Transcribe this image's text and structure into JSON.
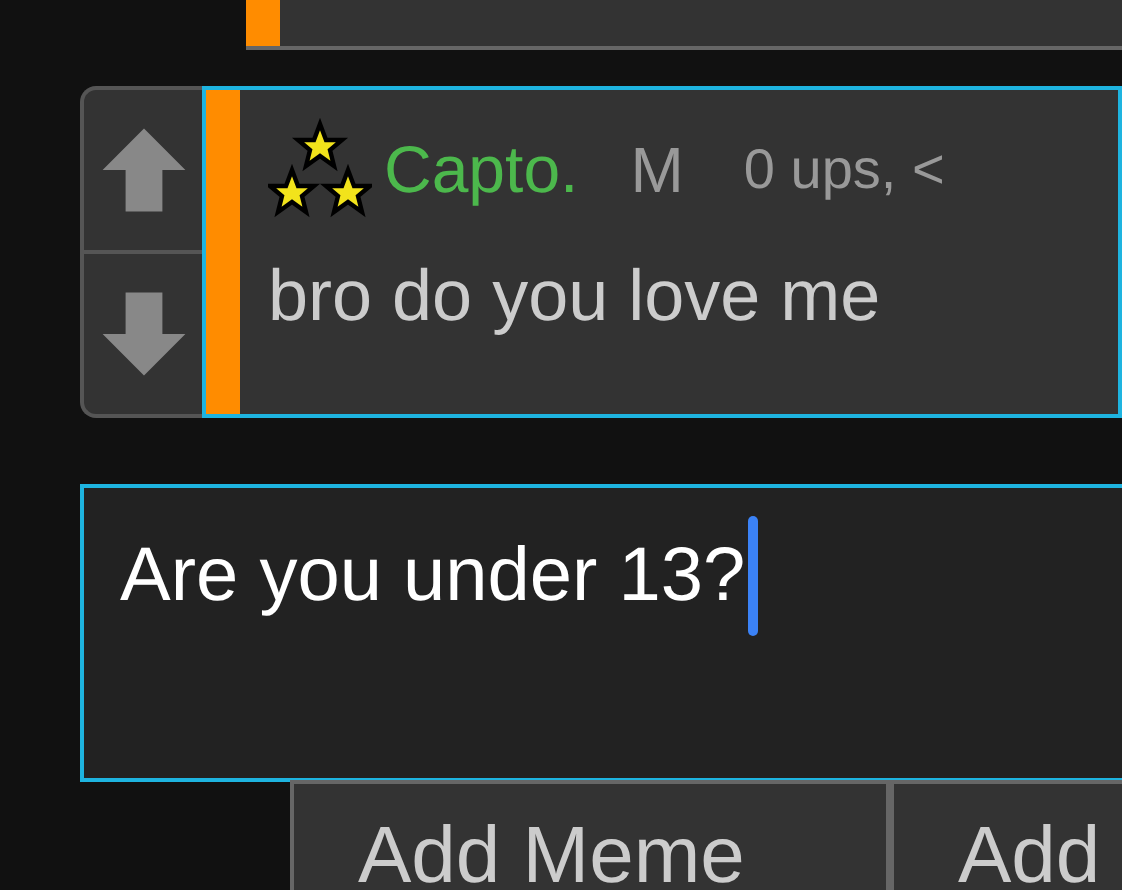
{
  "comment": {
    "vote_up": {
      "kind": "up"
    },
    "vote_down": {
      "kind": "down"
    },
    "author": "Capto.",
    "gender": "M",
    "stats": "0 ups, <",
    "text": "bro do you love me",
    "selected": true
  },
  "reply_box": {
    "value": "Are you under 13?",
    "focused": true
  },
  "buttons": [
    "Add Meme",
    "Add"
  ]
}
